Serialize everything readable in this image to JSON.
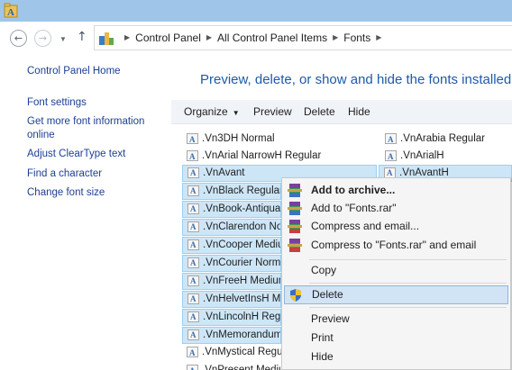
{
  "address": {
    "breadcrumbs": [
      "Control Panel",
      "All Control Panel Items",
      "Fonts"
    ]
  },
  "sidebar": {
    "home": "Control Panel Home",
    "links": [
      {
        "label": "Font settings"
      },
      {
        "label": "Get more font information online"
      },
      {
        "label": "Adjust ClearType text"
      },
      {
        "label": "Find a character"
      },
      {
        "label": "Change font size"
      }
    ]
  },
  "main": {
    "header": "Preview, delete, or show and hide the fonts installed o"
  },
  "toolbar": {
    "organize": "Organize",
    "preview": "Preview",
    "delete": "Delete",
    "hide": "Hide"
  },
  "fonts": {
    "col1": [
      {
        "name": ".Vn3DH Normal",
        "selected": false
      },
      {
        "name": ".VnArial NarrowH Regular",
        "selected": false
      },
      {
        "name": ".VnAvant",
        "selected": true
      },
      {
        "name": ".VnBlack Regular",
        "selected": true
      },
      {
        "name": ".VnBook-Antiqua",
        "selected": true
      },
      {
        "name": ".VnClarendon No",
        "selected": true
      },
      {
        "name": ".VnCooper Mediu",
        "selected": true
      },
      {
        "name": ".VnCourier Norma",
        "selected": true
      },
      {
        "name": ".VnFreeH Medium",
        "selected": true
      },
      {
        "name": ".VnHelvetInsH Me",
        "selected": true
      },
      {
        "name": ".VnLincolnH Regu",
        "selected": true
      },
      {
        "name": ".VnMemorandum",
        "selected": true
      },
      {
        "name": ".VnMystical Regul",
        "selected": false
      },
      {
        "name": ".VnPresent Medium",
        "selected": false
      }
    ],
    "col2": [
      {
        "name": ".VnArabia Regular",
        "selected": false
      },
      {
        "name": ".VnArialH",
        "selected": false
      },
      {
        "name": ".VnAvantH",
        "selected": true
      }
    ]
  },
  "context_menu": {
    "items": [
      {
        "label": "Add to archive...",
        "icon": "winrar-icon",
        "bold": true
      },
      {
        "label": "Add to \"Fonts.rar\"",
        "icon": "winrar-icon"
      },
      {
        "label": "Compress and email...",
        "icon": "winrar-icon"
      },
      {
        "label": "Compress to \"Fonts.rar\" and email",
        "icon": "winrar-icon"
      },
      {
        "label": "Copy"
      },
      {
        "label": "Delete",
        "icon": "uac-shield-icon",
        "highlighted": true
      },
      {
        "label": "Preview"
      },
      {
        "label": "Print"
      },
      {
        "label": "Hide"
      }
    ]
  },
  "colors": {
    "titlebar": "#9fc6e9",
    "link": "#1c3f94",
    "header": "#1e5aa8",
    "selection": "#cde6f7",
    "menu_highlight": "#d1e3f5"
  }
}
